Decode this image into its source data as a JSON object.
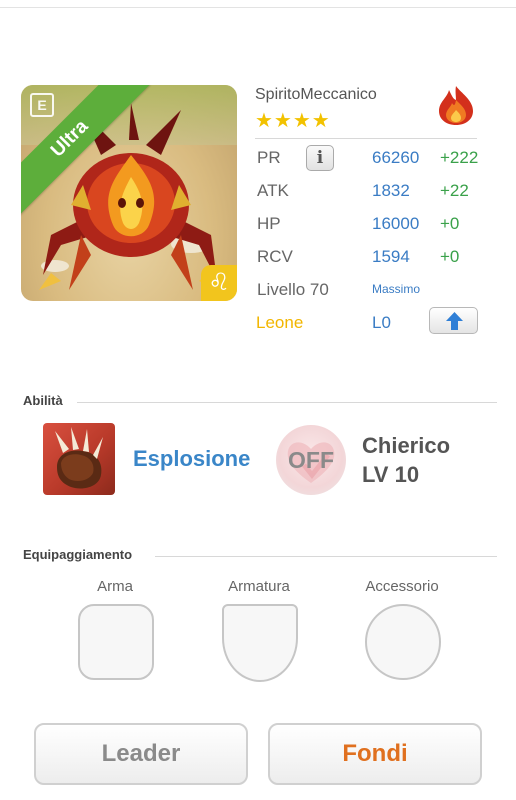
{
  "monster": {
    "name": "SpiritoMeccanico",
    "rarity_label": "Ultra",
    "stars": "★★★★",
    "star_count": 4,
    "element_icon": "fire-icon",
    "zodiac_symbol": "♌",
    "card_icon": "E"
  },
  "stats": [
    {
      "label": "PR",
      "value": "66260",
      "bonus": "+222"
    },
    {
      "label": "ATK",
      "value": "1832",
      "bonus": "+22"
    },
    {
      "label": "HP",
      "value": "16000",
      "bonus": "+0"
    },
    {
      "label": "RCV",
      "value": "1594",
      "bonus": "+0"
    }
  ],
  "info_button": "i",
  "level": {
    "label": "Livello 70",
    "status": "Massimo"
  },
  "zodiac": {
    "label": "Leone",
    "value": "L0"
  },
  "abilities": {
    "title": "Abilità",
    "skill_name": "Esplosione",
    "leader_skill_state": "OFF",
    "class_name": "Chierico",
    "class_level": "LV 10"
  },
  "equipment": {
    "title": "Equipaggiamento",
    "slots": [
      "Arma",
      "Armatura",
      "Accessorio"
    ]
  },
  "buttons": {
    "leader": "Leader",
    "fuse": "Fondi"
  },
  "colors": {
    "stat_value": "#3a7cc4",
    "stat_bonus": "#3aa14a",
    "rarity_ribbon": "#5dae3b",
    "zodiac": "#f2b600",
    "fuse_button_text": "#e0701f"
  }
}
